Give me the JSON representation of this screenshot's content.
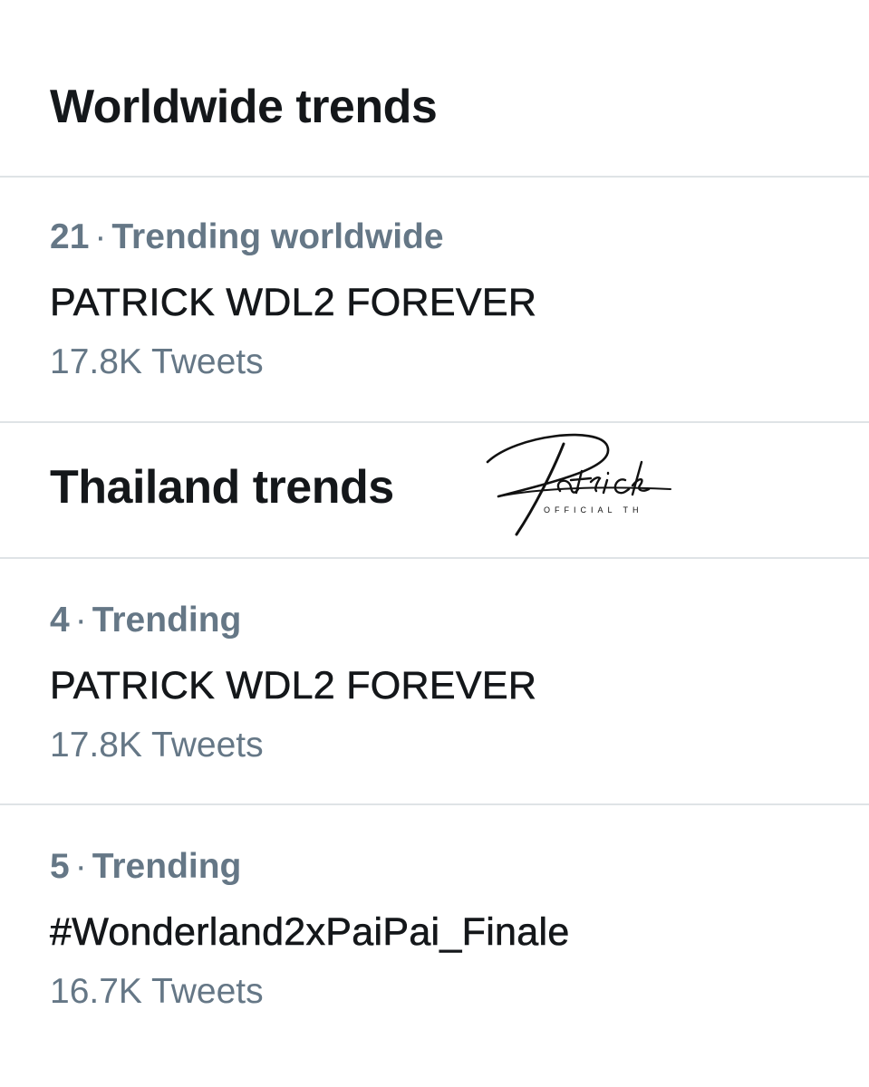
{
  "worldwide": {
    "title": "Worldwide trends",
    "trends": [
      {
        "rank": "21",
        "context": "Trending worldwide",
        "name": "PATRICK WDL2 FOREVER",
        "count": "17.8K Tweets"
      }
    ]
  },
  "thailand": {
    "title": "Thailand trends",
    "trends": [
      {
        "rank": "4",
        "context": "Trending",
        "name": "PATRICK WDL2 FOREVER",
        "count": "17.8K Tweets"
      },
      {
        "rank": "5",
        "context": "Trending",
        "name": "#Wonderland2xPaiPai_Finale",
        "count": "16.7K Tweets"
      }
    ]
  },
  "separator": "·",
  "logo": {
    "script_text": "Patrick",
    "subtitle": "OFFICIAL TH"
  },
  "colors": {
    "text_primary": "#14171a",
    "text_secondary": "#657786",
    "divider": "#dfe3e6",
    "background": "#ffffff"
  }
}
